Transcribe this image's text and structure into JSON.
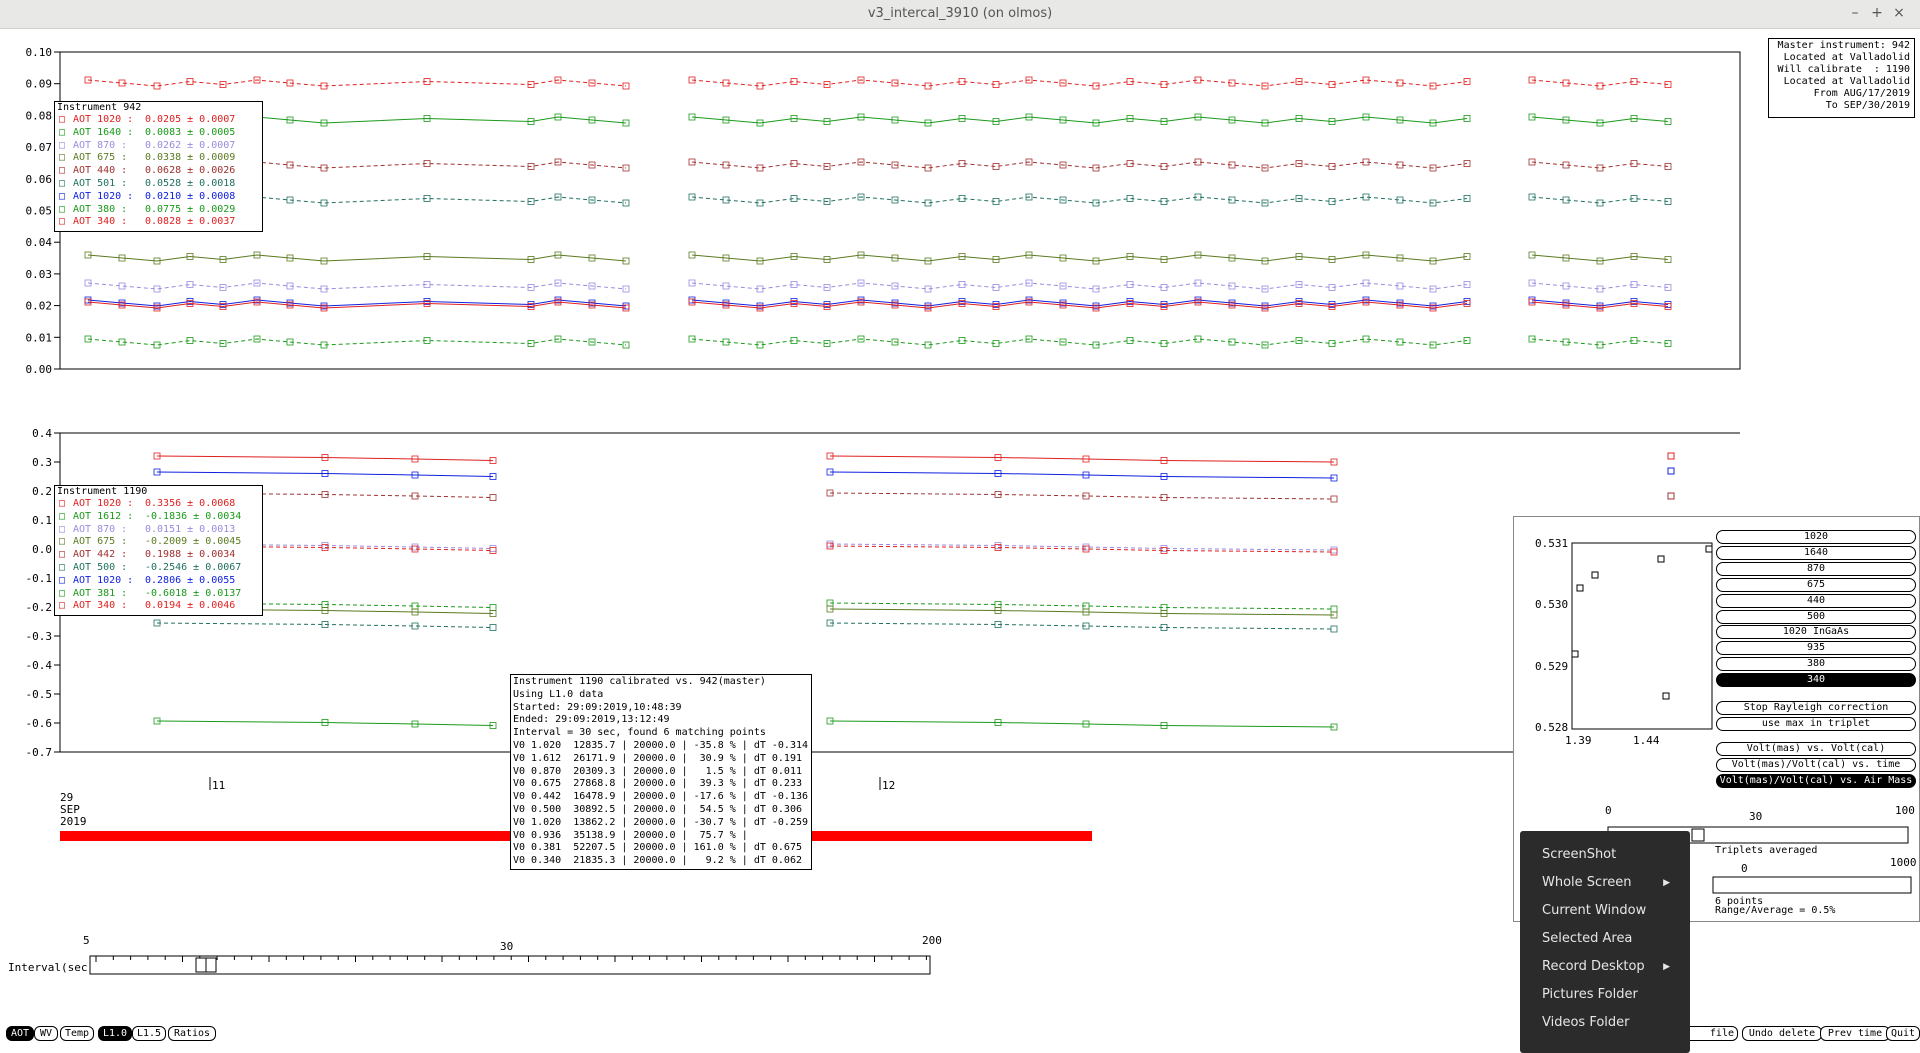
{
  "window": {
    "title": "v3_intercal_3910 (on olmos)",
    "min_btn": "–",
    "max_btn": "+",
    "close_btn": "×"
  },
  "top_plot": {
    "y_ticks": [
      "0.10",
      "0.09",
      "0.08",
      "0.07",
      "0.06",
      "0.05",
      "0.04",
      "0.03",
      "0.02",
      "0.01",
      "0.00"
    ],
    "info_lines": [
      "Master instrument: 942",
      "Located at Valladolid",
      "Will calibrate  : 1190",
      "Located at Valladolid",
      "From AUG/17/2019",
      "To SEP/30/2019"
    ],
    "legend_title": "Instrument 942",
    "legend": [
      {
        "label": "AOT 1020 :",
        "value": "0.0205 ± 0.0007",
        "color": "#e02020"
      },
      {
        "label": "AOT 1640 :",
        "value": "0.0083 ± 0.0005",
        "color": "#1a9a1a"
      },
      {
        "label": "AOT 870 :",
        "value": "0.0262 ± 0.0007",
        "color": "#9a8ae0"
      },
      {
        "label": "AOT 675 :",
        "value": "0.0338 ± 0.0009",
        "color": "#5a7a20"
      },
      {
        "label": "AOT 440 :",
        "value": "0.0628 ± 0.0026",
        "color": "#a03030"
      },
      {
        "label": "AOT 501 :",
        "value": "0.0528 ± 0.0018",
        "color": "#207060"
      },
      {
        "label": "AOT 1020 :",
        "value": "0.0210 ± 0.0008",
        "color": "#1020e0"
      },
      {
        "label": "AOT 380 :",
        "value": "0.0775 ± 0.0029",
        "color": "#1a9a1a"
      },
      {
        "label": "AOT 340 :",
        "value": "0.0828 ± 0.0037",
        "color": "#e02020"
      }
    ]
  },
  "bottom_plot": {
    "y_ticks": [
      "0.4",
      "0.3",
      "0.2",
      "0.1",
      "0.0",
      "-0.1",
      "-0.2",
      "-0.3",
      "-0.4",
      "-0.5",
      "-0.6",
      "-0.7"
    ],
    "legend_title": "Instrument 1190",
    "legend": [
      {
        "label": "AOT 1020 :",
        "value": "0.3356 ± 0.0068",
        "color": "#e02020"
      },
      {
        "label": "AOT 1612 :",
        "value": "-0.1836 ± 0.0034",
        "color": "#1a9a1a"
      },
      {
        "label": "AOT 870 :",
        "value": "0.0151 ± 0.0013",
        "color": "#9a8ae0"
      },
      {
        "label": "AOT 675 :",
        "value": "-0.2009 ± 0.0045",
        "color": "#5a7a20"
      },
      {
        "label": "AOT 442 :",
        "value": "0.1988 ± 0.0034",
        "color": "#a03030"
      },
      {
        "label": "AOT 500 :",
        "value": "-0.2546 ± 0.0067",
        "color": "#207060"
      },
      {
        "label": "AOT 1020 :",
        "value": "0.2806 ± 0.0055",
        "color": "#1020e0"
      },
      {
        "label": "AOT 381 :",
        "value": "-0.6018 ± 0.0137",
        "color": "#1a9a1a"
      },
      {
        "label": "AOT 340 :",
        "value": "0.0194 ± 0.0046",
        "color": "#e02020"
      }
    ]
  },
  "date_axis": {
    "day": "29",
    "month": "SEP",
    "year": "2019",
    "tick_11": "11",
    "tick_12": "12"
  },
  "calibration_info": [
    "Instrument 1190 calibrated vs. 942(master)",
    "Using L1.0 data",
    "Started: 29:09:2019,10:48:39",
    "Ended: 29:09:2019,13:12:49",
    "Interval = 30 sec, found 6 matching points",
    "V0 1.020  12835.7 | 20000.0 | -35.8 % | dT -0.314",
    "V0 1.612  26171.9 | 20000.0 |  30.9 % | dT 0.191",
    "V0 0.870  20309.3 | 20000.0 |   1.5 % | dT 0.011",
    "V0 0.675  27868.8 | 20000.0 |  39.3 % | dT 0.233",
    "V0 0.442  16478.9 | 20000.0 | -17.6 % | dT -0.136",
    "V0 0.500  30892.5 | 20000.0 |  54.5 % | dT 0.306",
    "V0 1.020  13862.2 | 20000.0 | -30.7 % | dT -0.259",
    "V0 0.936  35138.9 | 20000.0 |  75.7 % |",
    "V0 0.381  52207.5 | 20000.0 | 161.0 % | dT 0.675",
    "V0 0.340  21835.3 | 20000.0 |   9.2 % | dT 0.062"
  ],
  "interval_slider": {
    "label": "Interval(sec)",
    "min": "5",
    "mid": "30",
    "max": "200",
    "value": 30
  },
  "side_panel": {
    "mini_plot": {
      "y_ticks": [
        "0.531",
        "0.530",
        "0.529",
        "0.528"
      ],
      "x_ticks": [
        "1.39",
        "1.44"
      ]
    },
    "wavelength_buttons": [
      "1020",
      "1640",
      "870",
      "675",
      "440",
      "500",
      "1020 InGaAs",
      "935",
      "380",
      "340"
    ],
    "selected_wavelength": "340",
    "option_buttons": [
      "Stop Rayleigh correction",
      "use max in triplet"
    ],
    "mode_buttons": [
      "Volt(mas) vs. Volt(cal)",
      "Volt(mas)/Volt(cal) vs. time",
      "Volt(mas)/Volt(cal) vs. Air Mass"
    ],
    "selected_mode": "Volt(mas)/Volt(cal) vs. Air Mass",
    "triplet_slider": {
      "min": "0",
      "mid": "30",
      "max": "100",
      "label": "Triplets averaged"
    },
    "range_slider": {
      "min": "0",
      "max": "1000",
      "points": "6 points",
      "range": "Range/Average = 0.5%"
    }
  },
  "bottom_buttons": {
    "left": [
      "AOT",
      "WV",
      "Temp",
      "L1.0",
      "L1.5",
      "Ratios"
    ],
    "selected_left": [
      "AOT",
      "L1.0"
    ],
    "right": [
      "file",
      "Undo delete",
      "Prev time",
      "Quit"
    ]
  },
  "context_menu": {
    "items": [
      "ScreenShot",
      "Whole Screen",
      "Current Window",
      "Selected Area",
      "Record Desktop",
      "Pictures Folder",
      "Videos Folder"
    ],
    "submenu_items": [
      "Whole Screen",
      "Record Desktop"
    ]
  }
}
